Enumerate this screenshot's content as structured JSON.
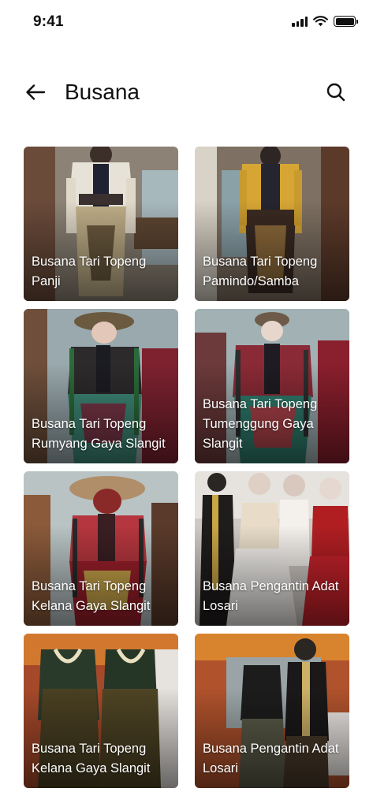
{
  "status_bar": {
    "time": "9:41"
  },
  "header": {
    "title": "Busana",
    "back_icon": "arrow-left-icon",
    "search_icon": "search-icon"
  },
  "cards": [
    {
      "label": "Busana Tari Topeng Panji"
    },
    {
      "label": "Busana Tari Topeng Pamindo/Samba"
    },
    {
      "label": "Busana Tari Topeng Rumyang Gaya Slangit"
    },
    {
      "label": "Busana Tari Topeng Tumenggung Gaya Slangit"
    },
    {
      "label": "Busana Tari Topeng Kelana Gaya Slangit"
    },
    {
      "label": "Busana Pengantin Adat Losari"
    },
    {
      "label": "Busana Tari Topeng Kelana Gaya Slangit"
    },
    {
      "label": "Busana Pengantin Adat Losari"
    }
  ]
}
